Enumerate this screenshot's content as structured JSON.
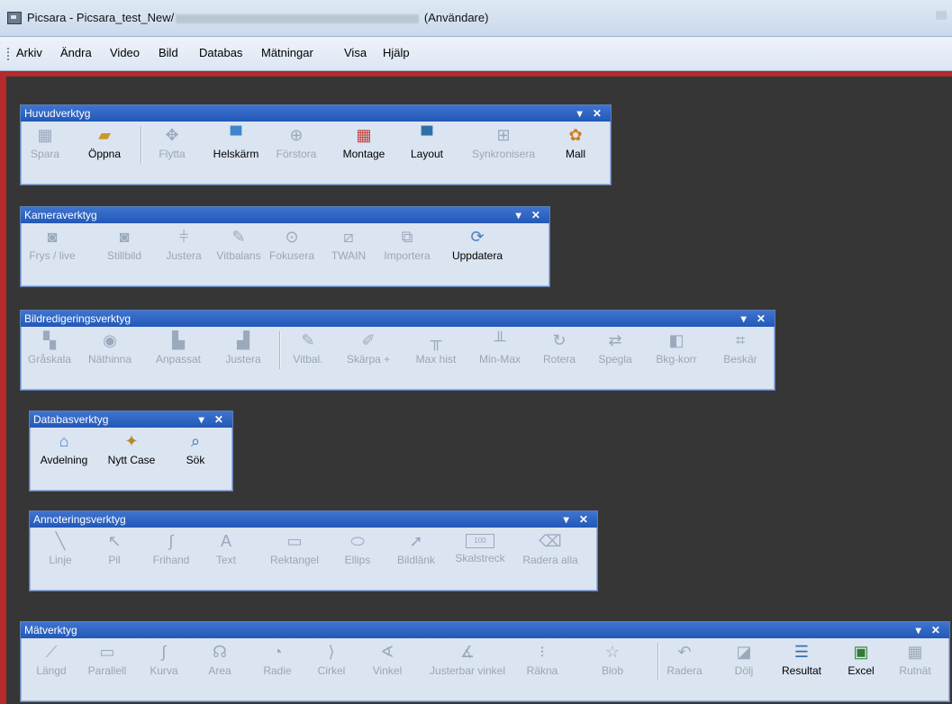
{
  "window": {
    "title_prefix": "Picsara - Picsara_test_New/",
    "title_suffix": "(Användare)"
  },
  "menu": [
    "Arkiv",
    "Ändra",
    "Video",
    "Bild",
    "Databas",
    "Mätningar",
    "Visa",
    "Hjälp"
  ],
  "toolbars": {
    "huvud": {
      "title": "Huvudverktyg",
      "controls": "▾ ✕",
      "tools": [
        {
          "label": "Spara",
          "icon": "save-icon",
          "enabled": false
        },
        {
          "label": "Öppna",
          "icon": "folder-open-icon",
          "enabled": true
        },
        {
          "label": "Flytta",
          "icon": "move-icon",
          "enabled": false
        },
        {
          "label": "Helskärm",
          "icon": "fullscreen-icon",
          "enabled": true
        },
        {
          "label": "Förstora",
          "icon": "zoom-icon",
          "enabled": false
        },
        {
          "label": "Montage",
          "icon": "montage-icon",
          "enabled": true
        },
        {
          "label": "Layout",
          "icon": "layout-icon",
          "enabled": true
        },
        {
          "label": "Synkronisera",
          "icon": "sync-icon",
          "enabled": false
        },
        {
          "label": "Mall",
          "icon": "palette-icon",
          "enabled": true
        }
      ]
    },
    "kamera": {
      "title": "Kameraverktyg",
      "controls": "▾ ✕",
      "tools": [
        {
          "label": "Frys / live",
          "icon": "camera-icon",
          "enabled": false
        },
        {
          "label": "Stillbild",
          "icon": "camera-still-icon",
          "enabled": false
        },
        {
          "label": "Justera",
          "icon": "sliders-icon",
          "enabled": false
        },
        {
          "label": "Vitbalans",
          "icon": "eyedropper-icon",
          "enabled": false
        },
        {
          "label": "Fokusera",
          "icon": "focus-icon",
          "enabled": false
        },
        {
          "label": "TWAIN",
          "icon": "scanner-icon",
          "enabled": false
        },
        {
          "label": "Importera",
          "icon": "import-icon",
          "enabled": false
        },
        {
          "label": "Uppdatera",
          "icon": "refresh-icon",
          "enabled": true
        }
      ]
    },
    "bildred": {
      "title": "Bildredigeringsverktyg",
      "controls": "▾ ✕",
      "tools": [
        {
          "label": "Gråskala",
          "icon": "grayscale-icon",
          "enabled": false
        },
        {
          "label": "Näthinna",
          "icon": "eye-icon",
          "enabled": false
        },
        {
          "label": "Anpassat",
          "icon": "histogram-icon",
          "enabled": false
        },
        {
          "label": "Justera",
          "icon": "adjust-histogram-icon",
          "enabled": false
        },
        {
          "label": "Vitbal.",
          "icon": "eyedropper-icon",
          "enabled": false
        },
        {
          "label": "Skärpa +",
          "icon": "sharpen-icon",
          "enabled": false
        },
        {
          "label": "Max hist",
          "icon": "max-hist-icon",
          "enabled": false
        },
        {
          "label": "Min-Max",
          "icon": "min-max-icon",
          "enabled": false
        },
        {
          "label": "Rotera",
          "icon": "rotate-icon",
          "enabled": false
        },
        {
          "label": "Spegla",
          "icon": "mirror-icon",
          "enabled": false
        },
        {
          "label": "Bkg-korr",
          "icon": "background-correction-icon",
          "enabled": false
        },
        {
          "label": "Beskär",
          "icon": "crop-icon",
          "enabled": false
        }
      ]
    },
    "databas": {
      "title": "Databasverktyg",
      "controls": "▾ ✕",
      "tools": [
        {
          "label": "Avdelning",
          "icon": "home-icon",
          "enabled": true
        },
        {
          "label": "Nytt Case",
          "icon": "new-case-icon",
          "enabled": true
        },
        {
          "label": "Sök",
          "icon": "search-icon",
          "enabled": true
        }
      ]
    },
    "annot": {
      "title": "Annoteringsverktyg",
      "controls": "▾ ✕",
      "tools": [
        {
          "label": "Linje",
          "icon": "line-icon",
          "enabled": false
        },
        {
          "label": "Pil",
          "icon": "arrow-icon",
          "enabled": false
        },
        {
          "label": "Frihand",
          "icon": "freehand-icon",
          "enabled": false
        },
        {
          "label": "Text",
          "icon": "text-icon",
          "enabled": false
        },
        {
          "label": "Rektangel",
          "icon": "rectangle-icon",
          "enabled": false
        },
        {
          "label": "Ellips",
          "icon": "ellipse-icon",
          "enabled": false
        },
        {
          "label": "Bildlänk",
          "icon": "cursor-icon",
          "enabled": false
        },
        {
          "label": "Skalstreck",
          "icon": "scalebar-icon",
          "enabled": false
        },
        {
          "label": "Radera alla",
          "icon": "eraser-icon",
          "enabled": false
        }
      ],
      "scale_value": "100"
    },
    "mat": {
      "title": "Mätverktyg",
      "controls": "▾ ✕",
      "tools": [
        {
          "label": "Längd",
          "icon": "ruler-icon",
          "enabled": false
        },
        {
          "label": "Parallell",
          "icon": "parallel-icon",
          "enabled": false
        },
        {
          "label": "Kurva",
          "icon": "curve-icon",
          "enabled": false
        },
        {
          "label": "Area",
          "icon": "area-icon",
          "enabled": false
        },
        {
          "label": "Radie",
          "icon": "radius-icon",
          "enabled": false
        },
        {
          "label": "Cirkel",
          "icon": "circle-icon",
          "enabled": false
        },
        {
          "label": "Vinkel",
          "icon": "angle-icon",
          "enabled": false
        },
        {
          "label": "Justerbar vinkel",
          "icon": "adjustable-angle-icon",
          "enabled": false
        },
        {
          "label": "Räkna",
          "icon": "count-icon",
          "enabled": false
        },
        {
          "label": "Blob",
          "icon": "blob-icon",
          "enabled": false
        },
        {
          "label": "Radera",
          "icon": "undo-icon",
          "enabled": false
        },
        {
          "label": "Dölj",
          "icon": "hide-icon",
          "enabled": false
        },
        {
          "label": "Resultat",
          "icon": "results-icon",
          "enabled": true
        },
        {
          "label": "Excel",
          "icon": "excel-icon",
          "enabled": true
        },
        {
          "label": "Rutnät",
          "icon": "grid-icon",
          "enabled": false
        }
      ]
    }
  }
}
